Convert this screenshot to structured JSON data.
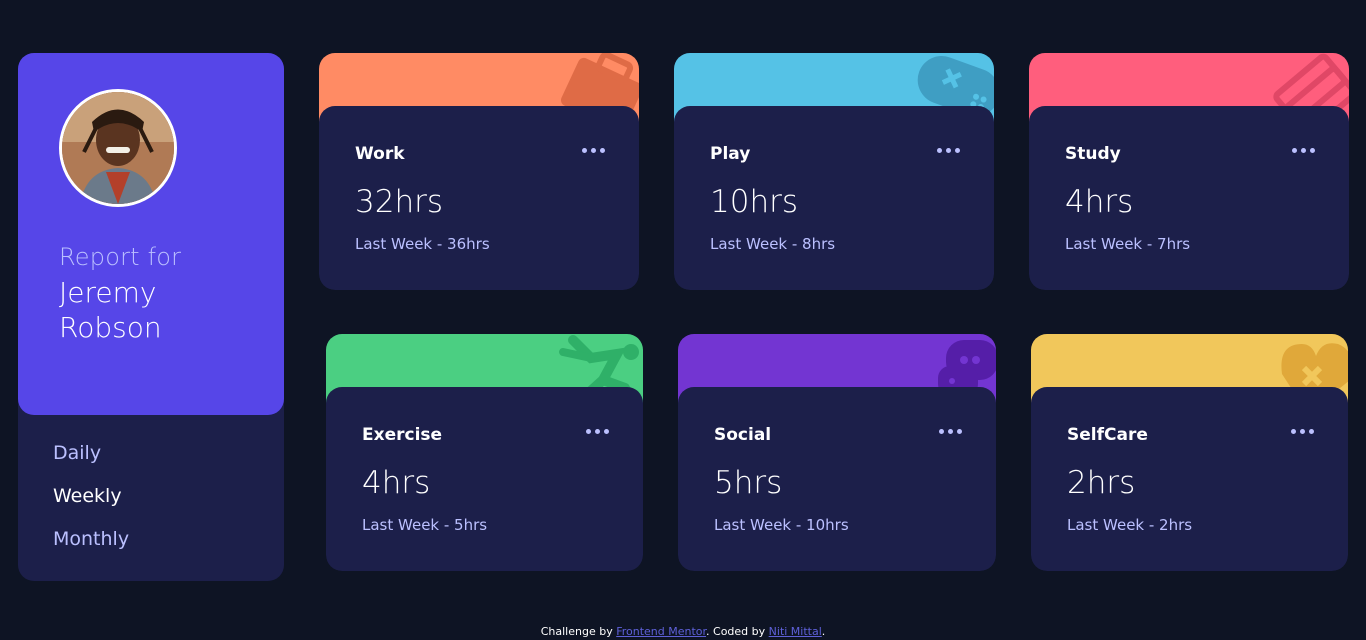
{
  "profile": {
    "report_label": "Report for",
    "name": "Jeremy Robson",
    "periods": [
      {
        "label": "Daily",
        "active": false
      },
      {
        "label": "Weekly",
        "active": true
      },
      {
        "label": "Monthly",
        "active": false
      }
    ]
  },
  "cards": [
    {
      "title": "Work",
      "hours": "32hrs",
      "previous": "Last Week - 36hrs",
      "color": "#ff8b64",
      "icon": "briefcase-icon"
    },
    {
      "title": "Play",
      "hours": "10hrs",
      "previous": "Last Week - 8hrs",
      "color": "#55c2e6",
      "icon": "gamepad-icon"
    },
    {
      "title": "Study",
      "hours": "4hrs",
      "previous": "Last Week - 7hrs",
      "color": "#ff5e7d",
      "icon": "book-icon"
    },
    {
      "title": "Exercise",
      "hours": "4hrs",
      "previous": "Last Week - 5hrs",
      "color": "#4bcf82",
      "icon": "runner-icon"
    },
    {
      "title": "Social",
      "hours": "5hrs",
      "previous": "Last Week - 10hrs",
      "color": "#7335d2",
      "icon": "chat-icon"
    },
    {
      "title": "SelfCare",
      "hours": "2hrs",
      "previous": "Last Week - 2hrs",
      "color": "#f1c75b",
      "icon": "heart-icon"
    }
  ],
  "footer": {
    "prefix": "Challenge by ",
    "link1": "Frontend Mentor",
    "middle": ". Coded by ",
    "link2": "Niti Mittal",
    "suffix": "."
  },
  "colors": {
    "background": "#0e1424",
    "card_body": "#1c1f4a",
    "profile_top": "#5646e8",
    "muted_text": "#bbc0ff"
  }
}
